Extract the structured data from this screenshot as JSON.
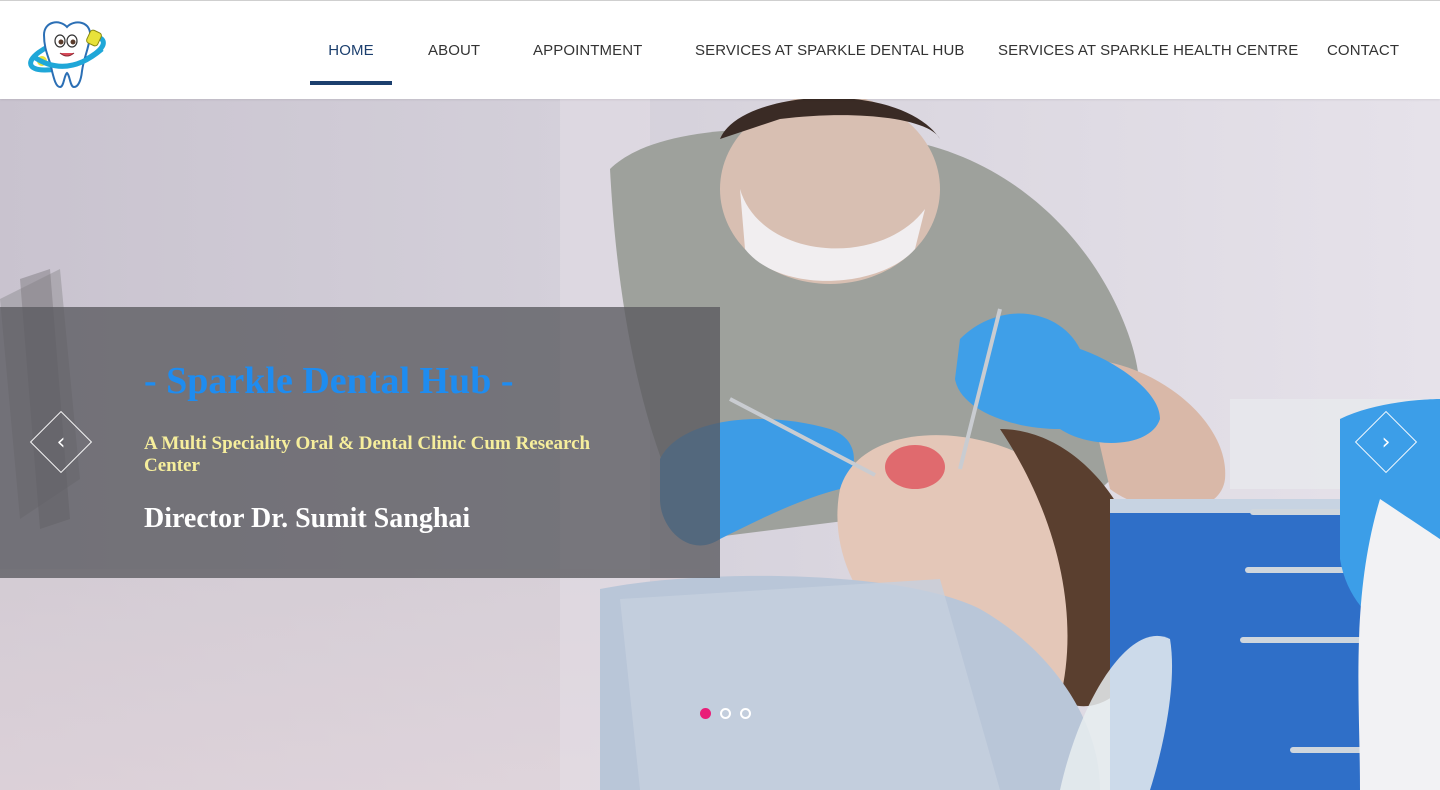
{
  "brand": {
    "logo": "tooth-mascot-logo"
  },
  "nav": {
    "items": [
      {
        "label": "HOME",
        "active": true
      },
      {
        "label": "ABOUT",
        "active": false
      },
      {
        "label": "APPOINTMENT",
        "active": false
      },
      {
        "label": "SERVICES AT SPARKLE DENTAL HUB",
        "active": false
      },
      {
        "label": "SERVICES AT SPARKLE HEALTH CENTRE",
        "active": false
      },
      {
        "label": "CONTACT",
        "active": false
      }
    ],
    "active_color": "#1c3f6e"
  },
  "hero": {
    "title": "- Sparkle Dental Hub -",
    "subtitle": "A Multi Speciality Oral & Dental Clinic Cum Research Center",
    "director": "Director Dr. Sumit Sanghai",
    "prev_icon": "chevron-left-icon",
    "next_icon": "chevron-right-icon",
    "prev_glyph": "‹",
    "next_glyph": "›",
    "slides_total": 3,
    "active_slide": 1,
    "colors": {
      "title": "#1e8cf0",
      "subtitle": "#f6ee9c",
      "director": "#ffffff",
      "dot_active": "#e91e78"
    }
  }
}
